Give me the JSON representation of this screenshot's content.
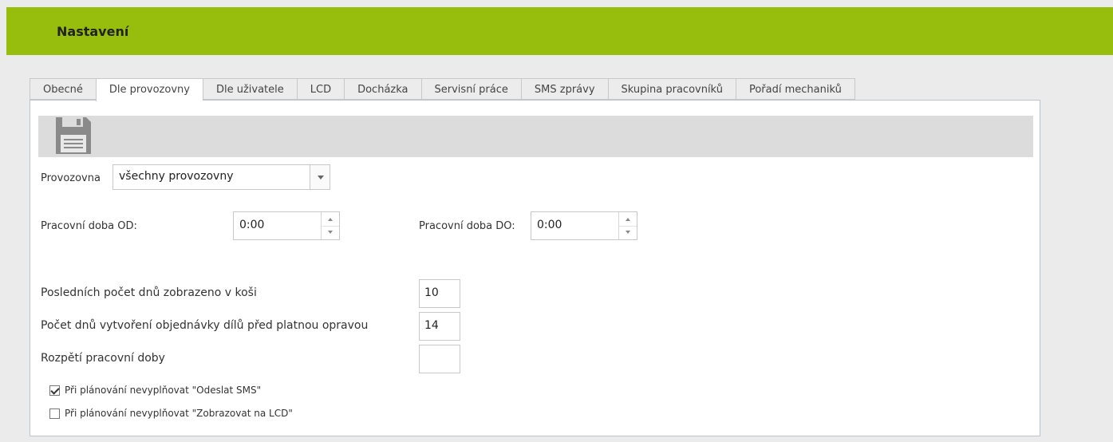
{
  "header": {
    "title": "Nastavení",
    "color": "#97bd0d"
  },
  "tabs": [
    {
      "label": "Obecné",
      "active": false
    },
    {
      "label": "Dle provozovny",
      "active": true
    },
    {
      "label": "Dle uživatele",
      "active": false
    },
    {
      "label": "LCD",
      "active": false
    },
    {
      "label": "Docházka",
      "active": false
    },
    {
      "label": "Servisní práce",
      "active": false
    },
    {
      "label": "SMS zprávy",
      "active": false
    },
    {
      "label": "Skupina pracovníků",
      "active": false
    },
    {
      "label": "Pořadí mechaniků",
      "active": false
    }
  ],
  "toolbar": {
    "save_icon": "floppy-disk-icon"
  },
  "form": {
    "provozovna": {
      "label": "Provozovna",
      "value": "všechny provozovny"
    },
    "pracovni_od": {
      "label": "Pracovní doba OD:",
      "value": "0:00"
    },
    "pracovni_do": {
      "label": "Pracovní doba DO:",
      "value": "0:00"
    },
    "pocet_dnu_kos": {
      "label": "Posledních počet dnů zobrazeno v koši",
      "value": "10"
    },
    "pocet_dnu_objednavka": {
      "label": "Počet dnů vytvoření objednávky dílů před platnou opravou",
      "value": "14"
    },
    "rozpeti": {
      "label": "Rozpětí pracovní doby",
      "value": ""
    },
    "checkbox_sms": {
      "label": "Při plánování nevyplňovat \"Odeslat SMS\"",
      "checked": true
    },
    "checkbox_lcd": {
      "label": "Při plánování nevyplňovat \"Zobrazovat na LCD\"",
      "checked": false
    }
  }
}
